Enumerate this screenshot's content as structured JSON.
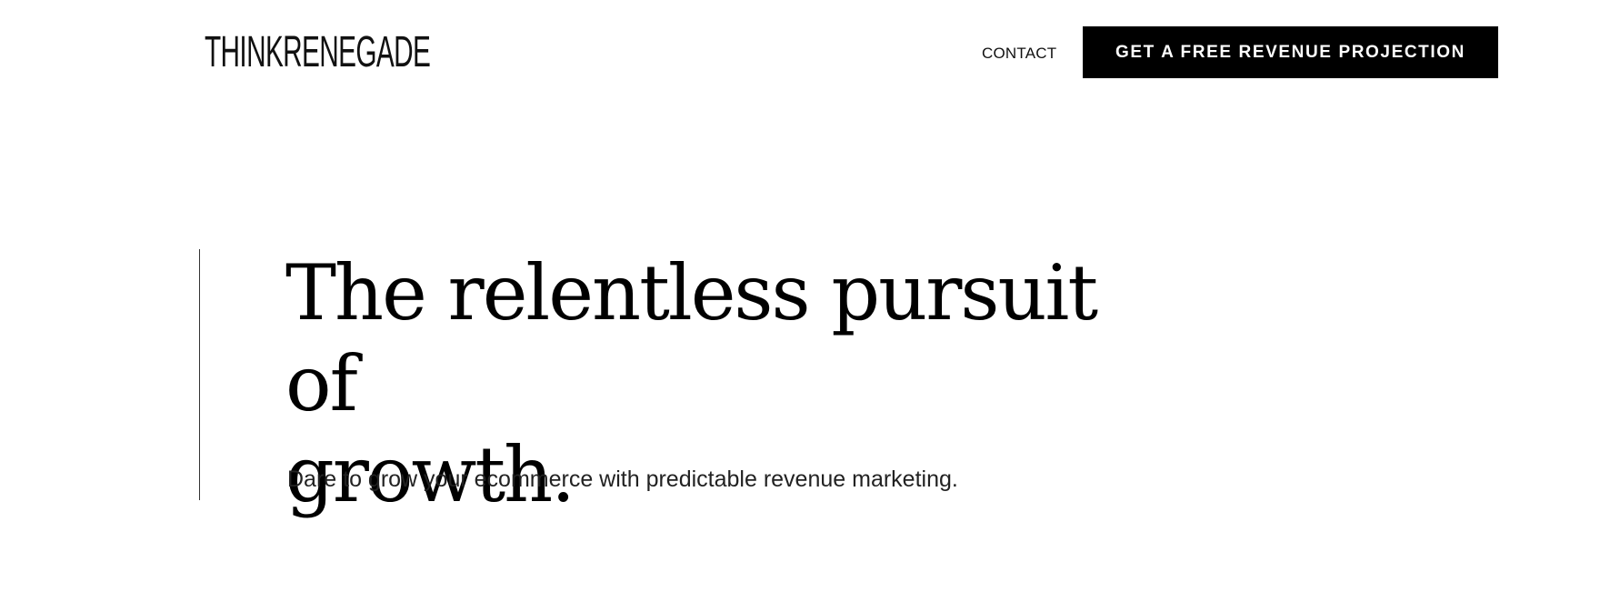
{
  "header": {
    "logo_text": "THINKRENEGADE",
    "nav": {
      "contact_label": "CONTACT"
    },
    "cta_label": "GET A FREE REVENUE PROJECTION"
  },
  "hero": {
    "title_line1": "The relentless pursuit of",
    "title_line2": "growth.",
    "subtitle": "Dare to grow your ecommerce with predictable revenue marketing."
  },
  "colors": {
    "background": "#ffffff",
    "text": "#000000",
    "button_bg": "#000000",
    "button_text": "#ffffff"
  }
}
